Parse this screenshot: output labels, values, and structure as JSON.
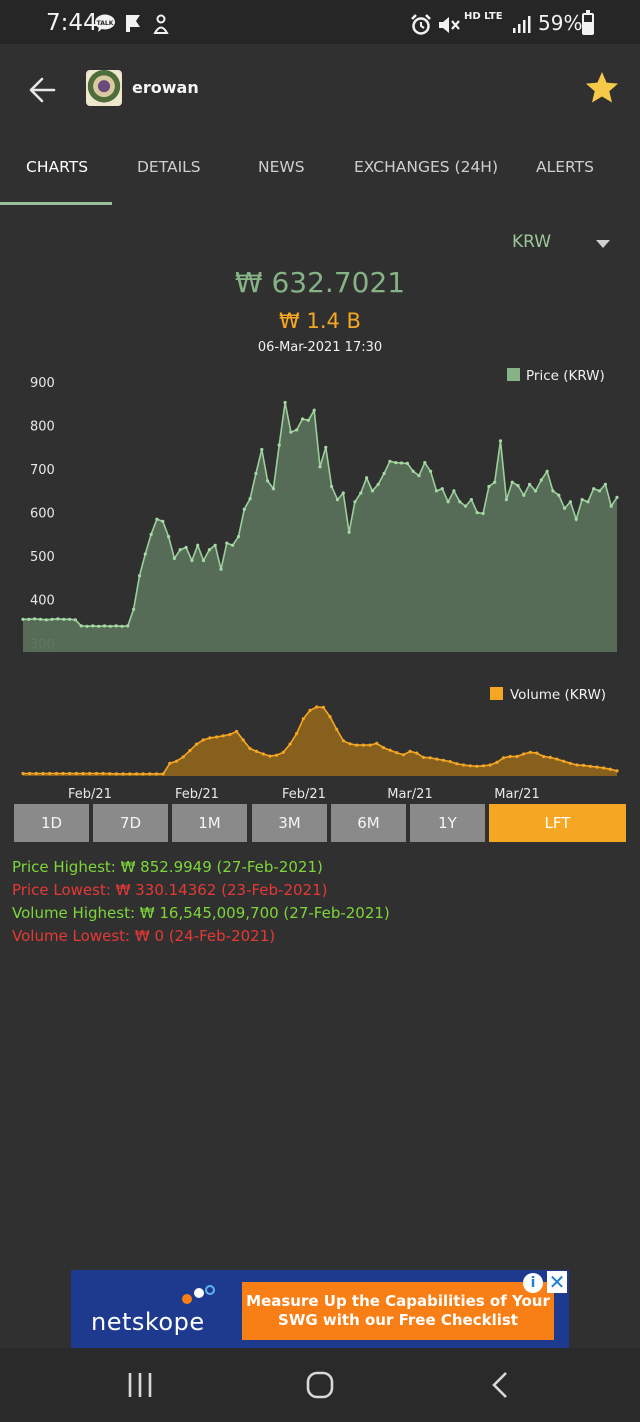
{
  "status_bar": {
    "time": "7:44",
    "network": "HD LTE",
    "battery": "59%",
    "battery_level": 0.59,
    "icons": [
      "talk-icon",
      "flag-icon",
      "notification-icon",
      "alarm-icon",
      "mute-icon",
      "signal-icon"
    ]
  },
  "header": {
    "coin_name": "erowan",
    "favorite": true,
    "star_color": "#f7c948"
  },
  "tabs": [
    {
      "label": "CHARTS",
      "active": true
    },
    {
      "label": "DETAILS",
      "active": false
    },
    {
      "label": "NEWS",
      "active": false
    },
    {
      "label": "EXCHANGES (24H)",
      "active": false
    },
    {
      "label": "ALERTS",
      "active": false
    }
  ],
  "currency": {
    "selected": "KRW"
  },
  "summary": {
    "price": "₩ 632.7021",
    "volume": "₩ 1.4 B",
    "datetime": "06-Mar-2021 17:30"
  },
  "colors": {
    "price": "#86b386",
    "volume": "#f5a623",
    "high": "#7dd63a",
    "low": "#e53935"
  },
  "chart_data": [
    {
      "type": "area",
      "series": [
        {
          "name": "Price (KRW)",
          "values": [
            355,
            355,
            356,
            355,
            354,
            355,
            356,
            355,
            355,
            354,
            340,
            339,
            340,
            339,
            340,
            339,
            340,
            339,
            340,
            378,
            455,
            505,
            550,
            585,
            580,
            545,
            495,
            515,
            520,
            490,
            525,
            490,
            515,
            525,
            470,
            530,
            525,
            545,
            608,
            632,
            690,
            745,
            673,
            655,
            755,
            853,
            785,
            790,
            815,
            812,
            835,
            705,
            750,
            660,
            630,
            645,
            555,
            625,
            645,
            680,
            650,
            665,
            690,
            718,
            715,
            714,
            713,
            695,
            685,
            715,
            695,
            650,
            655,
            625,
            650,
            625,
            615,
            630,
            600,
            598,
            660,
            670,
            765,
            630,
            670,
            662,
            640,
            665,
            650,
            675,
            695,
            650,
            640,
            610,
            625,
            585,
            630,
            625,
            655,
            650,
            665,
            615,
            635
          ]
        }
      ],
      "ylim": [
        280,
        900
      ],
      "yticks": [
        900,
        800,
        700,
        600,
        500,
        400,
        300
      ],
      "legend_position": "top-right"
    },
    {
      "type": "area",
      "series": [
        {
          "name": "Volume (KRW)",
          "values": [
            0.6,
            0.6,
            0.6,
            0.6,
            0.6,
            0.6,
            0.6,
            0.6,
            0.6,
            0.6,
            0.6,
            0.6,
            0.6,
            0.55,
            0.5,
            0.5,
            0.5,
            0.5,
            0.5,
            0.5,
            0.5,
            0.5,
            3,
            3.5,
            4.5,
            6,
            7.5,
            8.5,
            9,
            9.2,
            9.5,
            9.8,
            10.5,
            8.5,
            6.5,
            5.8,
            5.2,
            4.7,
            4.9,
            5.6,
            7.5,
            10,
            13.5,
            15.5,
            16.3,
            16.2,
            14,
            11,
            8.3,
            7.6,
            7.3,
            7.3,
            7.3,
            7.7,
            6.7,
            6.1,
            5.5,
            5,
            5.8,
            5.4,
            4.4,
            4.3,
            4,
            3.7,
            3.4,
            2.9,
            2.6,
            2.4,
            2.3,
            2.4,
            2.6,
            3.2,
            4.3,
            4.6,
            4.6,
            5.2,
            5.6,
            5.4,
            4.6,
            4.4,
            4.0,
            3.5,
            3.0,
            2.6,
            2.5,
            2.3,
            2.1,
            1.9,
            1.6,
            1.2
          ]
        }
      ],
      "ylim": [
        0,
        17
      ],
      "legend_position": "top-right",
      "x_tick_labels": [
        "Feb/21",
        "Feb/21",
        "Feb/21",
        "Mar/21",
        "Mar/21"
      ]
    }
  ],
  "ranges": [
    {
      "label": "1D",
      "active": false
    },
    {
      "label": "7D",
      "active": false
    },
    {
      "label": "1M",
      "active": false
    },
    {
      "label": "3M",
      "active": false
    },
    {
      "label": "6M",
      "active": false
    },
    {
      "label": "1Y",
      "active": false
    },
    {
      "label": "LFT",
      "active": true
    }
  ],
  "stats": {
    "price_highest": "Price Highest: ₩ 852.9949 (27-Feb-2021)",
    "price_lowest": "Price Lowest: ₩ 330.14362 (23-Feb-2021)",
    "volume_highest": "Volume Highest: ₩ 16,545,009,700 (27-Feb-2021)",
    "volume_lowest": "Volume Lowest: ₩ 0 (24-Feb-2021)"
  },
  "ad": {
    "brand": "netskope",
    "cta": "Measure Up the Capabilities of Your SWG with our Free Checklist"
  }
}
